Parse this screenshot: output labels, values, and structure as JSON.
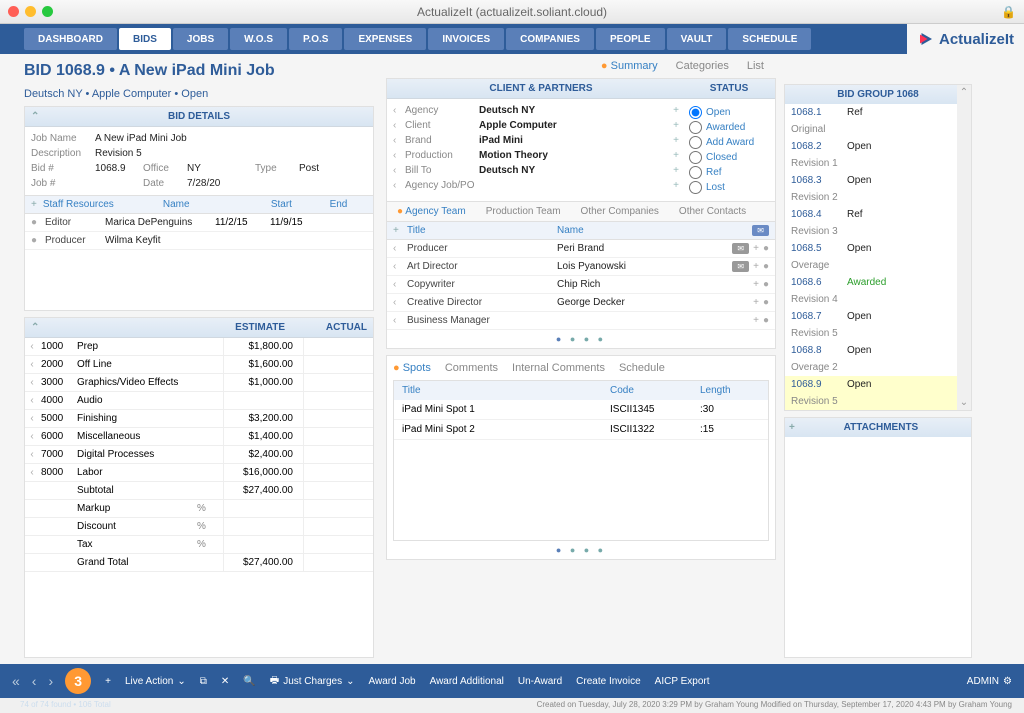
{
  "window": {
    "title": "ActualizeIt (actualizeit.soliant.cloud)"
  },
  "brand": {
    "name": "ActualizeIt"
  },
  "topnav": [
    "DASHBOARD",
    "BIDS",
    "JOBS",
    "W.O.S",
    "P.O.S",
    "EXPENSES",
    "INVOICES",
    "COMPANIES",
    "PEOPLE",
    "VAULT",
    "SCHEDULE"
  ],
  "page": {
    "title": "BID 1068.9 • A New iPad Mini Job",
    "subtitle": "Deutsch NY • Apple Computer • Open"
  },
  "subtabs": [
    "Summary",
    "Categories",
    "List"
  ],
  "bid_details": {
    "header": "BID DETAILS",
    "job_name_label": "Job Name",
    "job_name": "A New iPad Mini Job",
    "description_label": "Description",
    "description": "Revision 5",
    "bid_no_label": "Bid #",
    "bid_no": "1068.9",
    "office_label": "Office",
    "office": "NY",
    "type_label": "Type",
    "type": "Post",
    "job_no_label": "Job #",
    "job_no": "",
    "date_label": "Date",
    "date": "7/28/20"
  },
  "staff": {
    "header": "Staff Resources",
    "cols": {
      "name": "Name",
      "start": "Start",
      "end": "End"
    },
    "rows": [
      {
        "role": "Editor",
        "name": "Marica DePenguins",
        "start": "11/2/15",
        "end": "11/9/15"
      },
      {
        "role": "Producer",
        "name": "Wilma Keyfit",
        "start": "",
        "end": ""
      }
    ]
  },
  "estimate": {
    "cols": {
      "estimate": "ESTIMATE",
      "actual": "ACTUAL"
    },
    "lines": [
      {
        "num": "1000",
        "name": "Prep",
        "est": "$1,800.00"
      },
      {
        "num": "2000",
        "name": "Off Line",
        "est": "$1,600.00"
      },
      {
        "num": "3000",
        "name": "Graphics/Video Effects",
        "est": "$1,000.00"
      },
      {
        "num": "4000",
        "name": "Audio",
        "est": ""
      },
      {
        "num": "5000",
        "name": "Finishing",
        "est": "$3,200.00"
      },
      {
        "num": "6000",
        "name": "Miscellaneous",
        "est": "$1,400.00"
      },
      {
        "num": "7000",
        "name": "Digital Processes",
        "est": "$2,400.00"
      },
      {
        "num": "8000",
        "name": "Labor",
        "est": "$16,000.00"
      }
    ],
    "subtotal_label": "Subtotal",
    "subtotal": "$27,400.00",
    "markup_label": "Markup",
    "markup_pct": "%",
    "discount_label": "Discount",
    "discount_pct": "%",
    "tax_label": "Tax",
    "tax_pct": "%",
    "grand_label": "Grand Total",
    "grand": "$27,400.00"
  },
  "client_partners": {
    "header": "CLIENT & PARTNERS",
    "status_header": "STATUS",
    "rows": [
      {
        "label": "Agency",
        "value": "Deutsch NY"
      },
      {
        "label": "Client",
        "value": "Apple Computer"
      },
      {
        "label": "Brand",
        "value": "iPad Mini"
      },
      {
        "label": "Production",
        "value": "Motion Theory"
      },
      {
        "label": "Bill To",
        "value": "Deutsch NY"
      },
      {
        "label": "Agency Job/PO",
        "value": ""
      }
    ],
    "status_options": [
      "Open",
      "Awarded",
      "Add Award",
      "Closed",
      "Ref",
      "Lost"
    ],
    "status_selected": "Open"
  },
  "team_tabs": [
    "Agency Team",
    "Production Team",
    "Other Companies",
    "Other Contacts"
  ],
  "team": {
    "cols": {
      "title": "Title",
      "name": "Name"
    },
    "rows": [
      {
        "title": "Producer",
        "name": "Peri Brand",
        "mail": true
      },
      {
        "title": "Art Director",
        "name": "Lois Pyanowski",
        "mail": true
      },
      {
        "title": "Copywriter",
        "name": "Chip Rich",
        "mail": false
      },
      {
        "title": "Creative Director",
        "name": "George Decker",
        "mail": false
      },
      {
        "title": "Business Manager",
        "name": "",
        "mail": false
      }
    ]
  },
  "spot_tabs": [
    "Spots",
    "Comments",
    "Internal Comments",
    "Schedule"
  ],
  "spots": {
    "cols": {
      "title": "Title",
      "code": "Code",
      "length": "Length"
    },
    "rows": [
      {
        "title": "iPad Mini Spot 1",
        "code": "ISCII1345",
        "length": ":30"
      },
      {
        "title": "iPad Mini Spot 2",
        "code": "ISCII1322",
        "length": ":15"
      }
    ]
  },
  "bid_group": {
    "header": "BID GROUP 1068",
    "rows": [
      {
        "num": "1068.1",
        "status": "Ref",
        "sub": "Original"
      },
      {
        "num": "1068.2",
        "status": "Open",
        "sub": "Revision 1"
      },
      {
        "num": "1068.3",
        "status": "Open",
        "sub": "Revision 2"
      },
      {
        "num": "1068.4",
        "status": "Ref",
        "sub": "Revision 3"
      },
      {
        "num": "1068.5",
        "status": "Open",
        "sub": "Overage"
      },
      {
        "num": "1068.6",
        "status": "Awarded",
        "sub": "Revision 4",
        "awarded": true
      },
      {
        "num": "1068.7",
        "status": "Open",
        "sub": "Revision 5"
      },
      {
        "num": "1068.8",
        "status": "Open",
        "sub": "Overage 2"
      },
      {
        "num": "1068.9",
        "status": "Open",
        "sub": "Revision 5",
        "hl": true
      }
    ]
  },
  "attachments": {
    "header": "ATTACHMENTS"
  },
  "footer": {
    "count": "74 of 74 found • 106 Total",
    "live_action": "Live Action",
    "just_charges": "Just Charges",
    "award_job": "Award Job",
    "award_additional": "Award Additional",
    "unaward": "Un-Award",
    "create_invoice": "Create Invoice",
    "aicp_export": "AICP Export",
    "admin": "ADMIN"
  },
  "statusline": "Created on Tuesday, July 28, 2020 3:29 PM by Graham Young  Modified on Thursday, September 17, 2020 4:43 PM by Graham Young"
}
